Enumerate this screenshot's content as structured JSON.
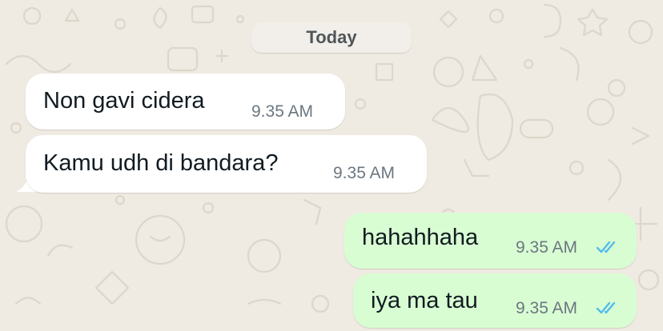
{
  "chat": {
    "date_separator": "Today",
    "messages": [
      {
        "direction": "incoming",
        "text": "Non gavi cidera",
        "time": "9.35 AM"
      },
      {
        "direction": "incoming",
        "text": "Kamu udh di bandara?",
        "time": "9.35 AM"
      },
      {
        "direction": "outgoing",
        "text": "hahahhaha",
        "time": "9.35 AM",
        "status": "read"
      },
      {
        "direction": "outgoing",
        "text": "iya ma tau",
        "time": "9.35 AM",
        "status": "read"
      }
    ]
  },
  "colors": {
    "background": "#efeae2",
    "incoming_bubble": "#ffffff",
    "outgoing_bubble": "#d9fdd3",
    "read_ticks": "#53bdeb",
    "time_text": "#6b7780"
  },
  "icons": {
    "read_status": "double-check-icon"
  }
}
